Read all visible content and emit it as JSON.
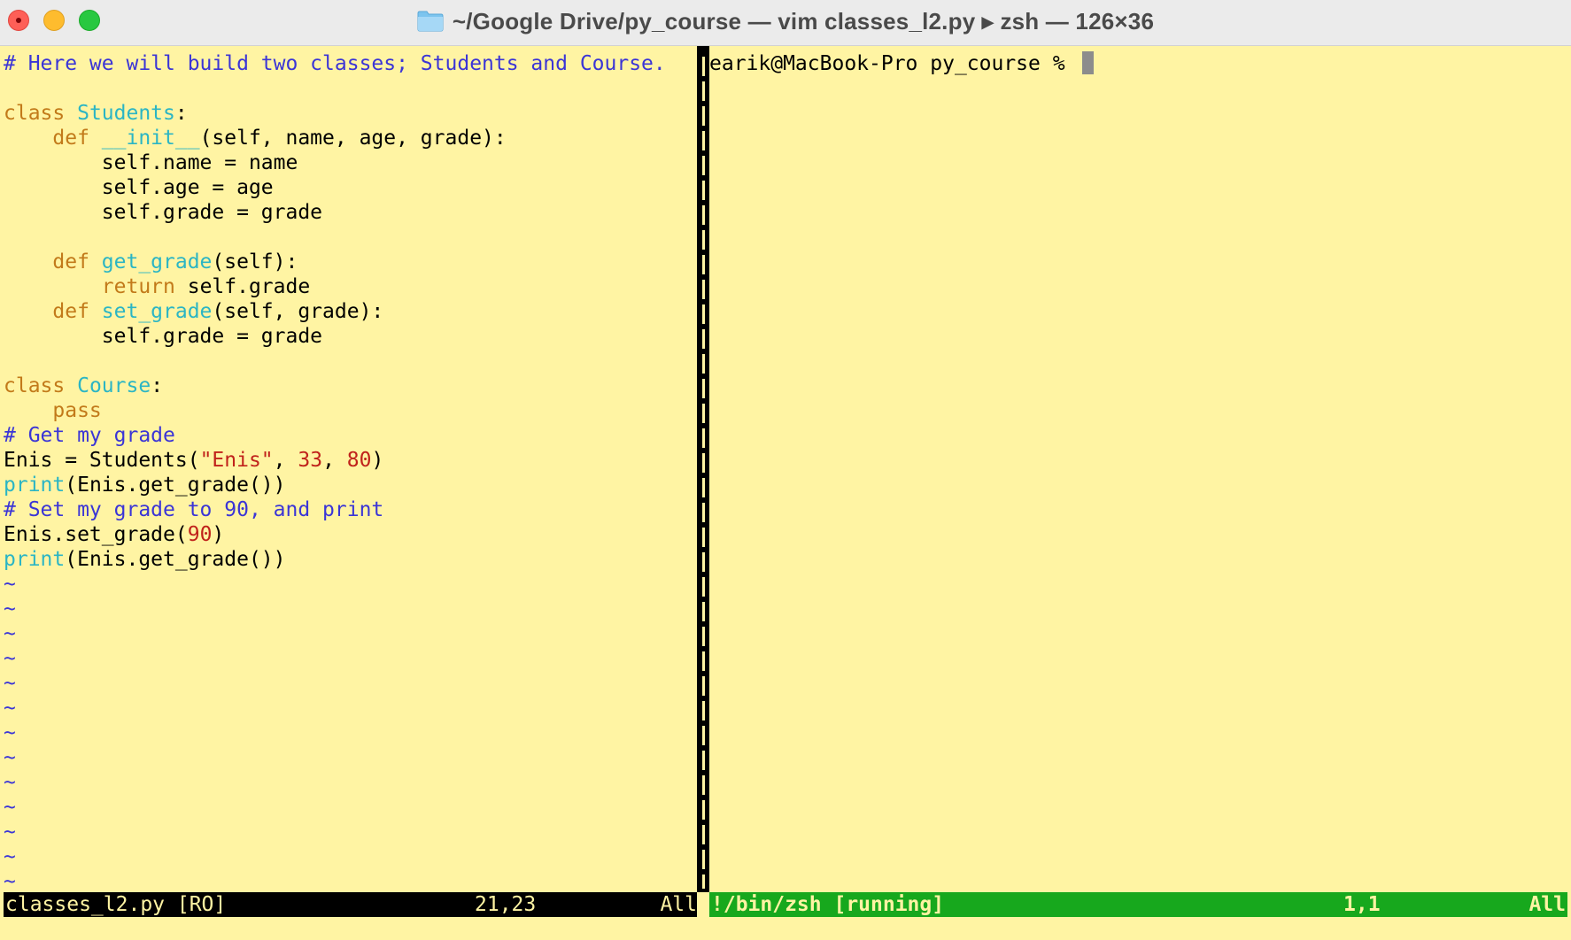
{
  "window": {
    "title": "~/Google Drive/py_course — vim classes_l2.py ▸ zsh — 126×36",
    "icon": "folder-icon"
  },
  "editor": {
    "lines": [
      [
        {
          "t": "# Here we will build two classes; Students and Course.",
          "k": "comment"
        }
      ],
      [],
      [
        {
          "t": "class ",
          "k": "keyword"
        },
        {
          "t": "Students",
          "k": "name"
        },
        {
          "t": ":",
          "k": "plain"
        }
      ],
      [
        {
          "t": "    ",
          "k": "plain"
        },
        {
          "t": "def ",
          "k": "keyword"
        },
        {
          "t": "__init__",
          "k": "name"
        },
        {
          "t": "(self, name, age, grade):",
          "k": "plain"
        }
      ],
      [
        {
          "t": "        self.name = name",
          "k": "plain"
        }
      ],
      [
        {
          "t": "        self.age = age",
          "k": "plain"
        }
      ],
      [
        {
          "t": "        self.grade = grade",
          "k": "plain"
        }
      ],
      [],
      [
        {
          "t": "    ",
          "k": "plain"
        },
        {
          "t": "def ",
          "k": "keyword"
        },
        {
          "t": "get_grade",
          "k": "name"
        },
        {
          "t": "(self):",
          "k": "plain"
        }
      ],
      [
        {
          "t": "        ",
          "k": "plain"
        },
        {
          "t": "return",
          "k": "keyword"
        },
        {
          "t": " self.grade",
          "k": "plain"
        }
      ],
      [
        {
          "t": "    ",
          "k": "plain"
        },
        {
          "t": "def ",
          "k": "keyword"
        },
        {
          "t": "set_grade",
          "k": "name"
        },
        {
          "t": "(self, grade):",
          "k": "plain"
        }
      ],
      [
        {
          "t": "        self.grade = grade",
          "k": "plain"
        }
      ],
      [],
      [
        {
          "t": "class ",
          "k": "keyword"
        },
        {
          "t": "Course",
          "k": "name"
        },
        {
          "t": ":",
          "k": "plain"
        }
      ],
      [
        {
          "t": "    ",
          "k": "plain"
        },
        {
          "t": "pass",
          "k": "keyword"
        }
      ],
      [
        {
          "t": "# Get my grade",
          "k": "comment"
        }
      ],
      [
        {
          "t": "Enis = Students(",
          "k": "plain"
        },
        {
          "t": "\"Enis\"",
          "k": "string"
        },
        {
          "t": ", ",
          "k": "plain"
        },
        {
          "t": "33",
          "k": "number"
        },
        {
          "t": ", ",
          "k": "plain"
        },
        {
          "t": "80",
          "k": "number"
        },
        {
          "t": ")",
          "k": "plain"
        }
      ],
      [
        {
          "t": "print",
          "k": "builtin"
        },
        {
          "t": "(Enis.get_grade())",
          "k": "plain"
        }
      ],
      [
        {
          "t": "# Set my grade to 90, and print",
          "k": "comment"
        }
      ],
      [
        {
          "t": "Enis.set_grade(",
          "k": "plain"
        },
        {
          "t": "90",
          "k": "number"
        },
        {
          "t": ")",
          "k": "plain"
        }
      ],
      [
        {
          "t": "print",
          "k": "builtin"
        },
        {
          "t": "(Enis.get_grade())",
          "k": "plain"
        }
      ]
    ],
    "tilde": "~",
    "tilde_count": 13,
    "status": {
      "file": "classes_l2.py [RO]",
      "position": "21,23",
      "scroll": "All"
    }
  },
  "terminal": {
    "prompt": "earik@MacBook-Pro py_course % ",
    "status": {
      "file": "!/bin/zsh [running]",
      "position": "1,1",
      "scroll": "All"
    }
  },
  "colors": {
    "background": "#fff4a3",
    "comment": "#3b35d6",
    "keyword": "#c27a1a",
    "name": "#2bb5c4",
    "string": "#c0221b",
    "status_left_bg": "#000000",
    "status_right_bg": "#17a81d"
  }
}
